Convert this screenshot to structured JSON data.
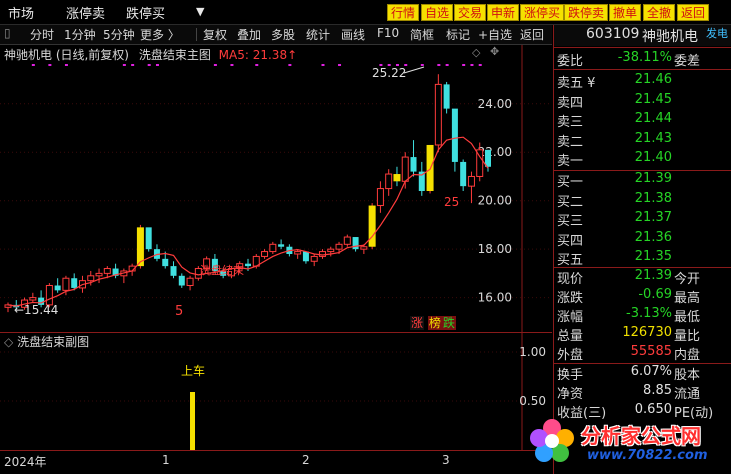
{
  "menu": [
    "市场",
    "涨停卖",
    "跌停买"
  ],
  "menu_arrow": "▼",
  "buttons": [
    "行情",
    "自选",
    "交易",
    "申新",
    "涨停买",
    "跌停卖",
    "撤单",
    "全撤",
    "返回"
  ],
  "toolbar": [
    "分时",
    "1分钟",
    "5分钟",
    "更多 〉",
    "复权",
    "叠加",
    "多股",
    "统计",
    "画线",
    "F10",
    "简框",
    "标记",
    "+自选",
    "返回"
  ],
  "title": {
    "name": "神驰机电 (日线,前复权)",
    "indicator": "洗盘结束主图",
    "ma_label": "MA5: 21.38",
    "ma_arrow": "↑"
  },
  "price_axis": [
    "24.00",
    "22.00",
    "20.00",
    "18.00",
    "16.00"
  ],
  "annotations": {
    "high": "25.22",
    "low": "15.44",
    "count_left": "5",
    "count_right": "25",
    "text_mid": "洗盘结束"
  },
  "badges": {
    "zhang": "涨",
    "bang": "榜",
    "die": "跌"
  },
  "sub_title": "洗盘结束副图",
  "sub_axis": [
    "1.00",
    "0.50"
  ],
  "sub_label": "上车",
  "time_axis": [
    "2024年",
    "1",
    "2",
    "3"
  ],
  "panel": {
    "code": "603109",
    "name": "神驰机电",
    "tag": "发电",
    "weibi_label": "委比",
    "weibi": "-38.11%",
    "weicha_label": "委差",
    "asks": [
      {
        "label": "卖五 ¥",
        "price": "21.46"
      },
      {
        "label": "卖四",
        "price": "21.45"
      },
      {
        "label": "卖三",
        "price": "21.44"
      },
      {
        "label": "卖二",
        "price": "21.43"
      },
      {
        "label": "卖一",
        "price": "21.40"
      }
    ],
    "bids": [
      {
        "label": "买一",
        "price": "21.39"
      },
      {
        "label": "买二",
        "price": "21.38"
      },
      {
        "label": "买三",
        "price": "21.37"
      },
      {
        "label": "买四",
        "price": "21.36"
      },
      {
        "label": "买五",
        "price": "21.35"
      }
    ],
    "quote": [
      {
        "l": "现价",
        "v": "21.39",
        "c": "green",
        "r": "今开"
      },
      {
        "l": "涨跌",
        "v": "-0.69",
        "c": "green",
        "r": "最高"
      },
      {
        "l": "涨幅",
        "v": "-3.13%",
        "c": "green",
        "r": "最低"
      },
      {
        "l": "总量",
        "v": "126730",
        "c": "yellow",
        "r": "量比"
      },
      {
        "l": "外盘",
        "v": "55585",
        "c": "red",
        "r": "内盘"
      }
    ],
    "fin": [
      {
        "l": "换手",
        "v": "6.07%",
        "r": "股本"
      },
      {
        "l": "净资",
        "v": "8.85",
        "r": "流通"
      },
      {
        "l": "收益(三)",
        "v": "0.650",
        "r": "PE(动)"
      }
    ]
  },
  "watermark": {
    "text": "分析家公式网",
    "url": "www.70822.com"
  },
  "colors": {
    "up": "#ff3c3c",
    "down": "#40e0e0",
    "signal": "#f5e000",
    "ma": "#ff3c3c"
  },
  "chart_data": {
    "type": "candlestick",
    "ylim": [
      15.2,
      25.6
    ],
    "candles": [
      [
        15.6,
        15.8,
        15.4,
        15.7
      ],
      [
        15.7,
        15.9,
        15.5,
        15.6
      ],
      [
        15.6,
        16.0,
        15.5,
        15.9
      ],
      [
        15.9,
        16.2,
        15.8,
        16.0
      ],
      [
        16.0,
        16.3,
        15.6,
        15.7
      ],
      [
        15.7,
        16.6,
        15.6,
        16.5
      ],
      [
        16.5,
        16.8,
        16.2,
        16.3
      ],
      [
        16.3,
        16.9,
        16.1,
        16.8
      ],
      [
        16.8,
        17.0,
        16.3,
        16.4
      ],
      [
        16.4,
        16.9,
        16.2,
        16.7
      ],
      [
        16.7,
        17.1,
        16.5,
        16.9
      ],
      [
        16.9,
        17.2,
        16.6,
        17.0
      ],
      [
        17.0,
        17.3,
        16.8,
        17.2
      ],
      [
        17.2,
        17.4,
        16.8,
        16.9
      ],
      [
        16.9,
        17.2,
        16.6,
        17.1
      ],
      [
        17.1,
        17.4,
        16.9,
        17.3
      ],
      [
        17.3,
        19.0,
        17.2,
        18.9
      ],
      [
        18.9,
        18.8,
        17.9,
        18.0
      ],
      [
        18.0,
        18.2,
        17.5,
        17.6
      ],
      [
        17.6,
        17.9,
        17.2,
        17.3
      ],
      [
        17.3,
        17.5,
        16.8,
        16.9
      ],
      [
        16.9,
        17.0,
        16.4,
        16.5
      ],
      [
        16.5,
        16.9,
        16.3,
        16.8
      ],
      [
        16.8,
        17.3,
        16.7,
        17.2
      ],
      [
        17.2,
        17.7,
        17.1,
        17.6
      ],
      [
        17.6,
        17.8,
        17.0,
        17.1
      ],
      [
        17.1,
        17.2,
        16.8,
        16.9
      ],
      [
        16.9,
        17.3,
        16.8,
        17.2
      ],
      [
        17.2,
        17.5,
        17.0,
        17.4
      ],
      [
        17.4,
        17.6,
        17.1,
        17.3
      ],
      [
        17.3,
        17.8,
        17.2,
        17.7
      ],
      [
        17.7,
        18.0,
        17.6,
        17.9
      ],
      [
        17.9,
        18.3,
        17.8,
        18.2
      ],
      [
        18.2,
        18.4,
        18.0,
        18.1
      ],
      [
        18.1,
        18.2,
        17.7,
        17.8
      ],
      [
        17.8,
        18.0,
        17.6,
        17.9
      ],
      [
        17.9,
        17.9,
        17.4,
        17.5
      ],
      [
        17.5,
        17.8,
        17.3,
        17.7
      ],
      [
        17.7,
        18.0,
        17.6,
        17.9
      ],
      [
        17.9,
        18.1,
        17.7,
        18.0
      ],
      [
        18.0,
        18.3,
        17.8,
        18.2
      ],
      [
        18.2,
        18.6,
        18.1,
        18.5
      ],
      [
        18.5,
        18.4,
        17.9,
        18.0
      ],
      [
        18.0,
        18.2,
        17.8,
        18.1
      ],
      [
        18.1,
        19.9,
        18.0,
        19.8
      ],
      [
        19.8,
        20.8,
        19.5,
        20.5
      ],
      [
        20.5,
        21.3,
        20.2,
        21.1
      ],
      [
        21.1,
        21.4,
        20.6,
        20.8
      ],
      [
        20.8,
        22.0,
        20.5,
        21.8
      ],
      [
        21.8,
        22.5,
        21.0,
        21.2
      ],
      [
        21.2,
        21.6,
        20.2,
        20.4
      ],
      [
        20.4,
        22.3,
        20.3,
        22.3
      ],
      [
        22.3,
        25.22,
        22.0,
        24.8
      ],
      [
        24.8,
        24.9,
        23.6,
        23.8
      ],
      [
        23.8,
        22.6,
        21.2,
        21.6
      ],
      [
        21.6,
        21.7,
        20.4,
        20.6
      ],
      [
        20.6,
        21.2,
        19.9,
        21.0
      ],
      [
        21.0,
        22.4,
        20.8,
        22.1
      ],
      [
        22.1,
        22.0,
        21.2,
        21.4
      ]
    ],
    "signals": [
      16,
      44,
      47,
      51
    ]
  }
}
